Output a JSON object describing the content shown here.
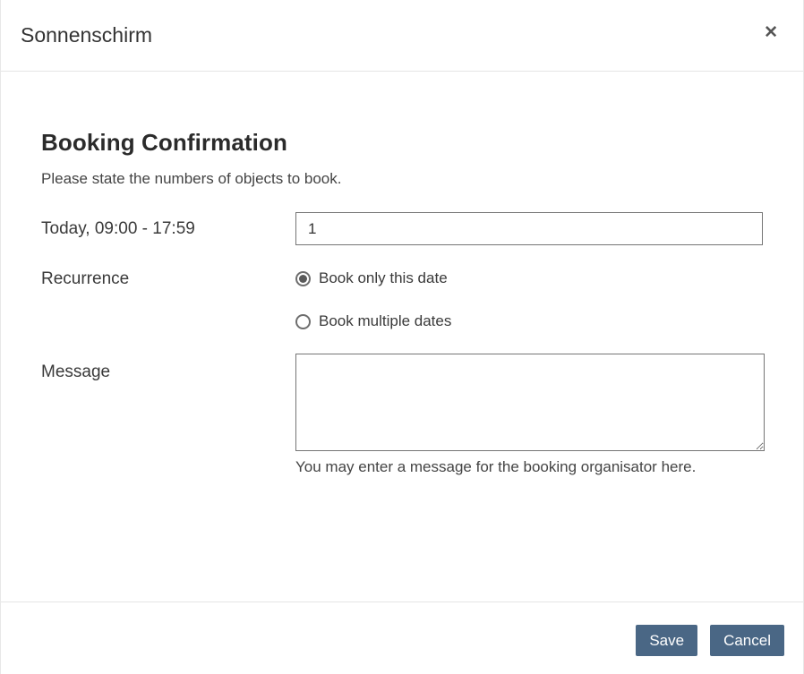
{
  "dialog": {
    "title": "Sonnenschirm",
    "close_icon": "✕"
  },
  "content": {
    "heading": "Booking Confirmation",
    "subtitle": "Please state the numbers of objects to book.",
    "rows": {
      "date": {
        "label": "Today, 09:00 - 17:59",
        "quantity_value": "1"
      },
      "recurrence": {
        "label": "Recurrence",
        "options": [
          {
            "label": "Book only this date",
            "selected": true
          },
          {
            "label": "Book multiple dates",
            "selected": false
          }
        ]
      },
      "message": {
        "label": "Message",
        "value": "",
        "help": "You may enter a message for the booking organisator here."
      }
    }
  },
  "footer": {
    "save_label": "Save",
    "cancel_label": "Cancel"
  },
  "colors": {
    "button_bg": "#4a6785",
    "text": "#333333",
    "divider": "#e5e5e5",
    "input_border": "#757575"
  }
}
